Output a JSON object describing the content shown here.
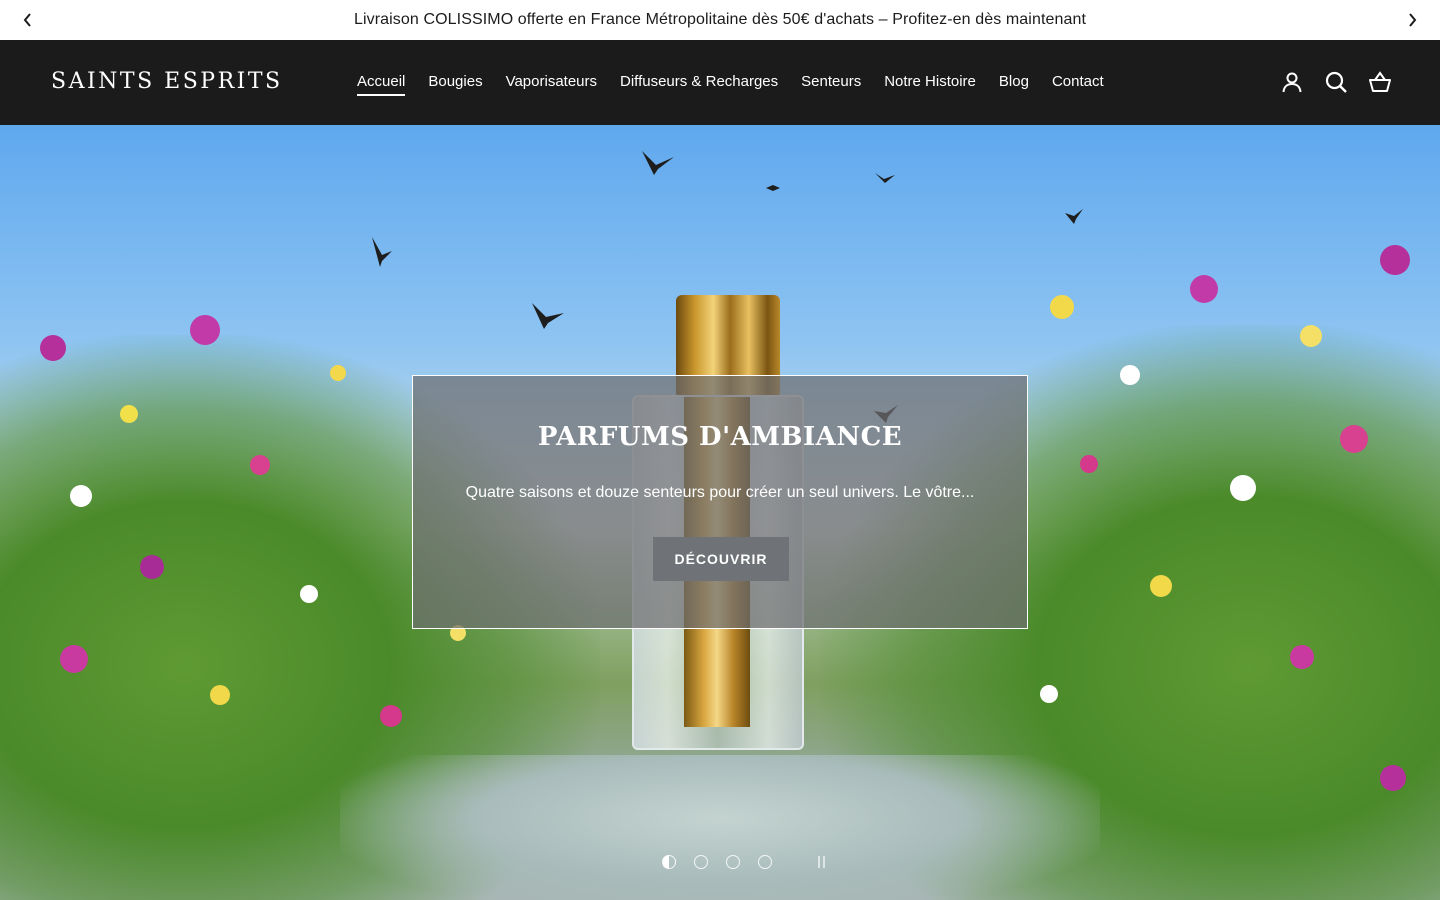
{
  "announcement": {
    "text": "Livraison COLISSIMO offerte en France Métropolitaine dès 50€ d'achats – Profitez-en dès maintenant",
    "prev_icon": "chevron-left-icon",
    "next_icon": "chevron-right-icon"
  },
  "header": {
    "logo": "Saints Esprits",
    "nav": [
      {
        "label": "Accueil",
        "active": true
      },
      {
        "label": "Bougies"
      },
      {
        "label": "Vaporisateurs"
      },
      {
        "label": "Diffuseurs & Recharges"
      },
      {
        "label": "Senteurs"
      },
      {
        "label": "Notre Histoire"
      },
      {
        "label": "Blog"
      },
      {
        "label": "Contact"
      }
    ],
    "icons": [
      "account-icon",
      "search-icon",
      "cart-icon"
    ]
  },
  "hero": {
    "title": "PARFUMS D'AMBIANCE",
    "subtitle": "Quatre saisons et douze senteurs pour créer un seul univers. Le vôtre...",
    "button_label": "DÉCOUVRIR",
    "slides_count": 4,
    "active_slide": 1
  },
  "colors": {
    "header_bg": "#1b1b1b",
    "announcement_bg": "#ffffff",
    "overlay_bg": "#6e6e70",
    "button_bg": "#6f7276"
  }
}
